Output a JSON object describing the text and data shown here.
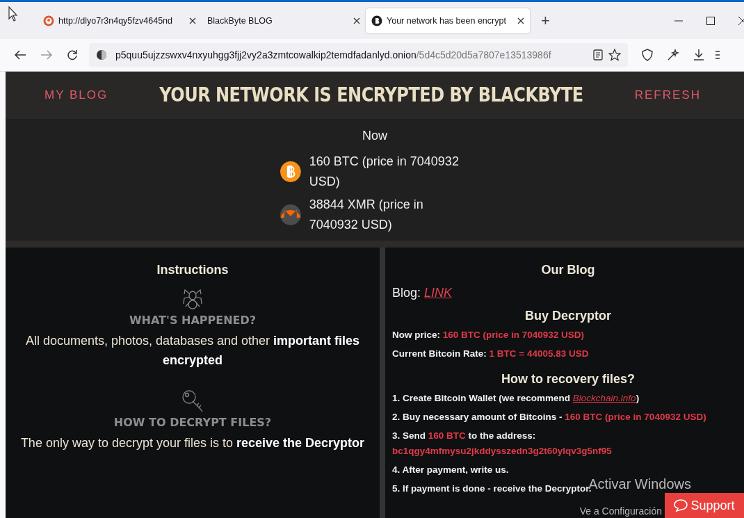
{
  "browser": {
    "tabs": [
      {
        "title": "http://dlyo7r3n4qy5fzv4645nd",
        "selected": false
      },
      {
        "title": "BlackByte BLOG",
        "selected": false
      },
      {
        "title": "Your network has been encrypt",
        "selected": true
      }
    ],
    "new_tab": "+",
    "address": {
      "host": "p5quu5ujzzswxv4nxyuhgg3fjj2vy2a3zmtcowalkip2temdfadanlyd.onion",
      "path": "/5d4c5d20d5a7807e13513986f"
    }
  },
  "header": {
    "left_link": "MY BLOG",
    "title": "YOUR NETWORK IS ENCRYPTED BY BLACKBYTE",
    "right_link": "REFRESH"
  },
  "price": {
    "label": "Now",
    "items": [
      {
        "kind": "btc",
        "text": "160 BTC (price in 7040932 USD)"
      },
      {
        "kind": "xmr",
        "text": "38844 XMR (price in 7040932 USD)"
      }
    ]
  },
  "instructions": {
    "title": "Instructions",
    "sections": [
      {
        "heading": "WHAT'S HAPPENED?",
        "text": "All documents, photos, databases and other **important files encrypted**"
      },
      {
        "heading": "HOW TO DECRYPT FILES?",
        "text": "The only way to decrypt your files is to **receive the Decryptor**"
      }
    ]
  },
  "blog": {
    "title": "Our Blog",
    "label": "Blog:",
    "link": "LINK",
    "buy_title": "Buy Decryptor",
    "lines": [
      [
        {
          "kind": "plain",
          "text": "Now price: "
        },
        {
          "kind": "accent",
          "text": "160 BTC (price in 7040932 USD)"
        }
      ],
      [
        {
          "kind": "plain",
          "text": "Current Bitcoin Rate: "
        },
        {
          "kind": "accent",
          "text": "1 BTC = 44005.83 USD"
        }
      ]
    ],
    "how_title": "How to recovery files?",
    "steps": [
      [
        {
          "kind": "plain",
          "text": "1. Create Bitcoin Wallet (we recommend "
        },
        {
          "kind": "link",
          "text": "Blockchain.info"
        },
        {
          "kind": "plain",
          "text": ")"
        }
      ],
      [
        {
          "kind": "plain",
          "text": "2. Buy necessary amount of Bitcoins - "
        },
        {
          "kind": "accent",
          "text": "160 BTC (price in 7040932 USD)"
        }
      ],
      [
        {
          "kind": "plain",
          "text": "3. Send "
        },
        {
          "kind": "accent",
          "text": "160 BTC"
        },
        {
          "kind": "plain",
          "text": " to the address:"
        },
        {
          "kind": "break"
        },
        {
          "kind": "accent",
          "text": "bc1qgy4mfmysu2jkddysszedn3g2t60ylqv3g5nf95"
        }
      ],
      [
        {
          "kind": "plain",
          "text": "4. After payment, write us."
        }
      ],
      [
        {
          "kind": "plain",
          "text": "5. If payment is done - receive the Decryptor."
        }
      ]
    ]
  },
  "support": "Support",
  "os_notice": {
    "title": "Activar Windows",
    "subtitle": "Ve a Configuración"
  }
}
